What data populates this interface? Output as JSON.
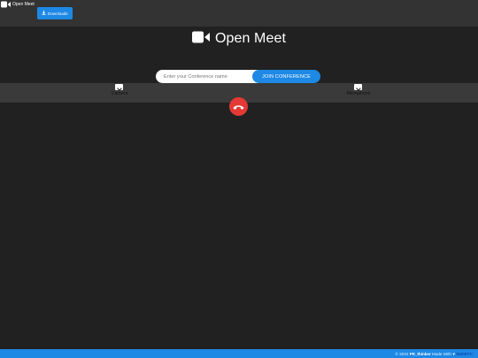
{
  "nav": {
    "brand": "Open Meet",
    "downloads_label": "Downloads"
  },
  "hero": {
    "title": "Open Meet"
  },
  "join": {
    "placeholder": "Enter your Conference name",
    "value": "",
    "button_label": "JOIN CONFERENCE"
  },
  "devices": {
    "camera_label": "Camera",
    "mic_label": "Microphone"
  },
  "footer": {
    "copyright": "© 2022",
    "author": "FR_thinker",
    "made_with": "Made With",
    "tech": "WebRTC"
  },
  "colors": {
    "background": "#212121",
    "topbar": "#333333",
    "accent": "#1e88e5",
    "hangup": "#e53935"
  },
  "icons": [
    "video-camera-icon",
    "download-icon",
    "chevron-down-icon",
    "phone-hangup-icon",
    "heart-icon"
  ]
}
